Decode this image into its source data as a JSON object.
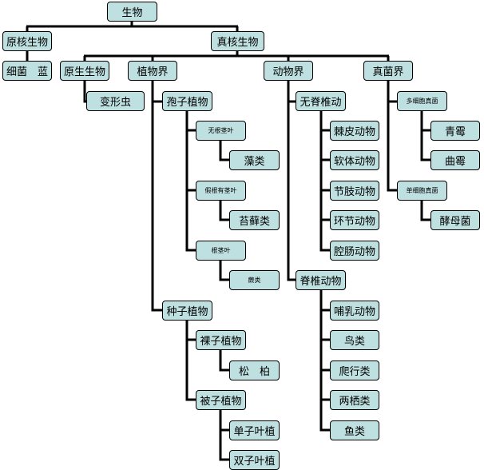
{
  "diagram": {
    "line_color": "#000000",
    "box_fill": "#bfe0e0",
    "nodes": {
      "root": "生物",
      "prokaryote": "原核生物",
      "eukaryote": "真核生物",
      "bacteria": "细菌　蓝",
      "protist": "原生生物",
      "plant": "植物界",
      "animal": "动物界",
      "fungi": "真菌界",
      "amoeba": "变形虫",
      "spore_plant": "孢子植物",
      "invertebrate": "无脊椎动",
      "multicell_fungi": "多细胞真菌",
      "no_root_stem_leaf": "无根茎叶",
      "echinoderm": "棘皮动物",
      "penicillium": "青霉",
      "algae": "藻类",
      "mollusk": "软体动物",
      "aspergillus": "曲霉",
      "pseudo_root": "假根有茎叶",
      "arthropod": "节肢动物",
      "unicell_fungi": "单细胞真菌",
      "moss": "苔藓类",
      "annelid": "环节动物",
      "yeast": "酵母菌",
      "root_stem_leaf": "根茎叶",
      "coelenterate": "腔肠动物",
      "fern": "蕨类",
      "vertebrate": "脊椎动物",
      "seed_plant": "种子植物",
      "mammal": "哺乳动物",
      "gymnosperm": "裸子植物",
      "bird": "鸟类",
      "pine": "松　柏",
      "reptile": "爬行类",
      "angiosperm": "被子植物",
      "amphibian": "两栖类",
      "monocot": "单子叶植",
      "fish": "鱼类",
      "dicot": "双子叶植"
    }
  }
}
